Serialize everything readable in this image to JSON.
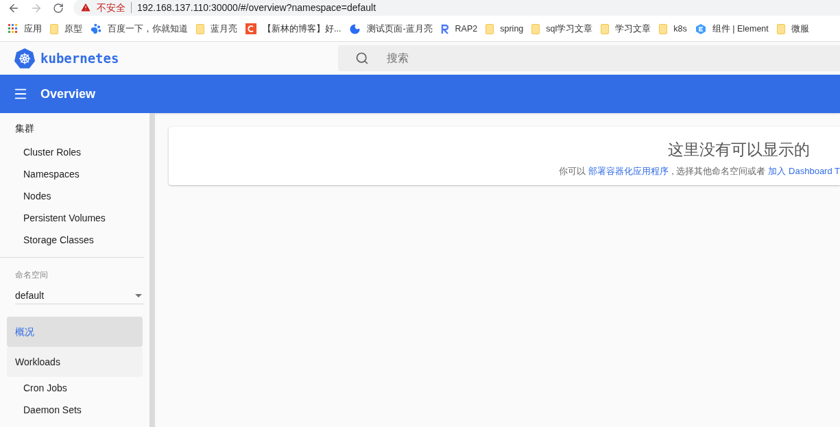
{
  "browser": {
    "security_label": "不安全",
    "url": "192.168.137.110:30000/#/overview?namespace=default"
  },
  "bookmarks": [
    {
      "kind": "apps",
      "label": "应用"
    },
    {
      "kind": "folder",
      "label": "原型"
    },
    {
      "kind": "paw",
      "label": "百度一下，你就知道"
    },
    {
      "kind": "folder",
      "label": "蓝月亮"
    },
    {
      "kind": "c",
      "label": "【新林的博客】好..."
    },
    {
      "kind": "moon",
      "label": "测试页面-蓝月亮"
    },
    {
      "kind": "r",
      "label": "RAP2"
    },
    {
      "kind": "folder",
      "label": "spring"
    },
    {
      "kind": "folder",
      "label": "sql学习文章"
    },
    {
      "kind": "folder",
      "label": "学习文章"
    },
    {
      "kind": "folder",
      "label": "k8s"
    },
    {
      "kind": "element",
      "label": "组件 | Element"
    },
    {
      "kind": "folder",
      "label": "微服"
    }
  ],
  "header": {
    "logo_text": "kubernetes",
    "search": {
      "placeholder": "搜索"
    }
  },
  "toolbar": {
    "title": "Overview"
  },
  "sidebar": {
    "cluster": {
      "heading": "集群",
      "items": [
        "Cluster Roles",
        "Namespaces",
        "Nodes",
        "Persistent Volumes",
        "Storage Classes"
      ]
    },
    "namespace": {
      "label": "命名空间",
      "value": "default"
    },
    "nav": [
      {
        "kind": "item",
        "label": "概况",
        "selected": true
      },
      {
        "kind": "group",
        "label": "Workloads",
        "selected": false
      },
      {
        "kind": "subitem",
        "label": "Cron Jobs",
        "selected": false
      },
      {
        "kind": "subitem",
        "label": "Daemon Sets",
        "selected": false
      }
    ]
  },
  "main": {
    "card": {
      "title": "这里没有可以显示的",
      "message": [
        {
          "kind": "text",
          "text": "你可以"
        },
        {
          "kind": "link",
          "text": "部署容器化应用程序"
        },
        {
          "kind": "text",
          "text": ", 选择其他命名空间或者"
        },
        {
          "kind": "link",
          "text": "加入 Dashboard T"
        }
      ]
    }
  }
}
